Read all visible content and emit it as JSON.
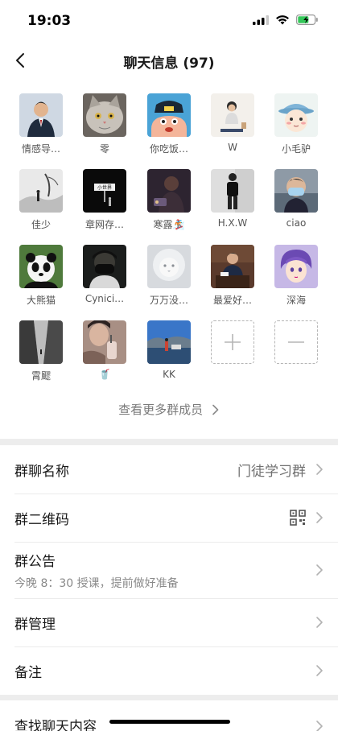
{
  "status": {
    "time": "19:03"
  },
  "header": {
    "back_icon": "chevron-left-icon",
    "title": "聊天信息 (97)"
  },
  "members": [
    {
      "name": "情感导…",
      "avatar": "man-suit"
    },
    {
      "name": "零",
      "avatar": "cat"
    },
    {
      "name": "你吃饭…",
      "avatar": "cartoon-police"
    },
    {
      "name": "W",
      "avatar": "person-sitting"
    },
    {
      "name": "小毛驴",
      "avatar": "cartoon-bucket-hat"
    },
    {
      "name": "佳少",
      "avatar": "landscape-mono"
    },
    {
      "name": "章网存…",
      "avatar": "black-sign"
    },
    {
      "name": "寒露🏂",
      "avatar": "dark-figure"
    },
    {
      "name": "H.X.W",
      "avatar": "person-standing"
    },
    {
      "name": "ciao",
      "avatar": "man-mask"
    },
    {
      "name": "大熊猫",
      "avatar": "panda"
    },
    {
      "name": "Cynici…",
      "avatar": "masked-man"
    },
    {
      "name": "万万没…",
      "avatar": "white-lion"
    },
    {
      "name": "最爱好…",
      "avatar": "man-desk"
    },
    {
      "name": "深海",
      "avatar": "anime-boy"
    },
    {
      "name": "霄飂",
      "avatar": "alley"
    },
    {
      "name": "🥤",
      "avatar": "selfie-drink"
    },
    {
      "name": "KK",
      "avatar": "scenery"
    }
  ],
  "add_icon": "plus-icon",
  "remove_icon": "minus-icon",
  "more_members": "查看更多群成员",
  "settings": {
    "group_name_label": "群聊名称",
    "group_name_value": "门徒学习群",
    "qr_label": "群二维码",
    "qr_icon": "qr-code-icon",
    "notice_label": "群公告",
    "notice_text": "今晚 8：30 授课，提前做好准备",
    "manage_label": "群管理",
    "remark_label": "备注",
    "search_label": "查找聊天内容"
  },
  "colors": {
    "bg": "#ededed",
    "panel": "#ffffff",
    "text": "#191919",
    "subtext": "#8a8a8a",
    "battery": "#34c759"
  }
}
